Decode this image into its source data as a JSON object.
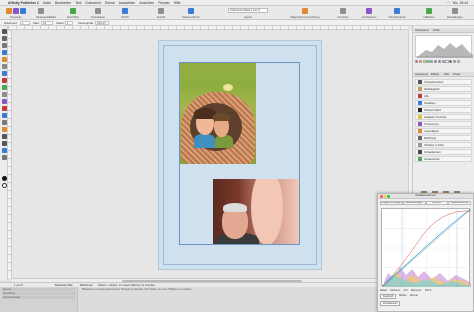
{
  "menubar": {
    "app_name": "Affinity Publisher 2",
    "items": [
      "Datei",
      "Bearbeiten",
      "Text",
      "Dokument",
      "Ebene",
      "Auswählen",
      "Ansichten",
      "Fenster",
      "Hilfe"
    ],
    "right_text": "Mo. 18:44"
  },
  "toolbar": {
    "labels": [
      "Personas",
      "Hintergrundbilder",
      "Ausrichten",
      "Formatieren",
      "Schrift",
      "Ansicht",
      "Seitenumbruch",
      "Zwischenablage",
      "Vorschau",
      "Layout",
      "Magnetische Ausrichtung",
      "Anordnen",
      "Kombinieren",
      "Transformieren",
      "Hilfslinien",
      "Einstellungen"
    ],
    "zoom_value": "Unbenannt (Seite 1 von 1)",
    "colors": {
      "blue": "#3a7bd5",
      "purple": "#8a57c5",
      "orange": "#e08a2c",
      "green": "#4ca64c",
      "grey": "#8e8e8e"
    }
  },
  "context_bar": {
    "label_dokument": "Dokument:",
    "value_dokument": "1",
    "label_start": "Start:",
    "value_start": "A4",
    "label_seiten": "Seiten:",
    "value_seiten": "1",
    "label_masze": "Seitengröße:",
    "value_masze": "210 mm",
    "extra": "Platzierung"
  },
  "status": {
    "page_label": "1 von 8",
    "hint": "Bildrahmen",
    "hint2": "Klicken + Ziehen, um neuen Rahmen zu erstellen",
    "buttons": [
      "Bearbeiten",
      "Bild"
    ]
  },
  "bottom_panel": {
    "lines": [
      "Ebenen",
      "Grundlinien",
      "Zwischenablage"
    ],
    "message": "Bildrahmen mit weich gezeichnetem Hintergrund (Rechts). Hier klicken, um neue Hilfslinien zu erstellen."
  },
  "right_panel": {
    "tabs_top": [
      "Histogramm",
      "Farbe"
    ],
    "tabs_mid": [
      "Anpassung",
      "Effekte",
      "Stile",
      "Pinsel"
    ],
    "adjustments": [
      "Tonwertkorrektur",
      "Weißabgleich",
      "HSL",
      "Gradation",
      "Schwarz-Weiß",
      "Helligkeit / Kontrast",
      "Tontrennung",
      "Lebendigkeit",
      "Belichtung",
      "Schatten / Lichter",
      "Schwellenwert",
      "Kanalmischer"
    ],
    "thumb_labels": [
      "Standard",
      "Sat. 50",
      "Weich",
      "Verblasst"
    ],
    "swatch_colors": [
      "#ff0000",
      "#ff8800",
      "#ffee00",
      "#44cc44",
      "#00bbdd",
      "#3355ff",
      "#9944cc",
      "#ff44aa",
      "#ffffff",
      "#000000",
      "#888888",
      "#c0c0c0"
    ]
  },
  "curves_dialog": {
    "title": "Gradationskurven",
    "tabs": [
      "Vorgabe hinzufügen",
      "Zusammenfügen",
      "Löschen",
      "Zusammenführen"
    ],
    "channel_label": "Master",
    "min_label": "Minimum:",
    "min_value": "0 %",
    "max_label": "Maximum:",
    "max_value": "100 %",
    "mode_label": "Modus:",
    "mode_value": "Normal",
    "buttons": [
      "Deckkraft",
      "Zurücksetzen"
    ]
  }
}
